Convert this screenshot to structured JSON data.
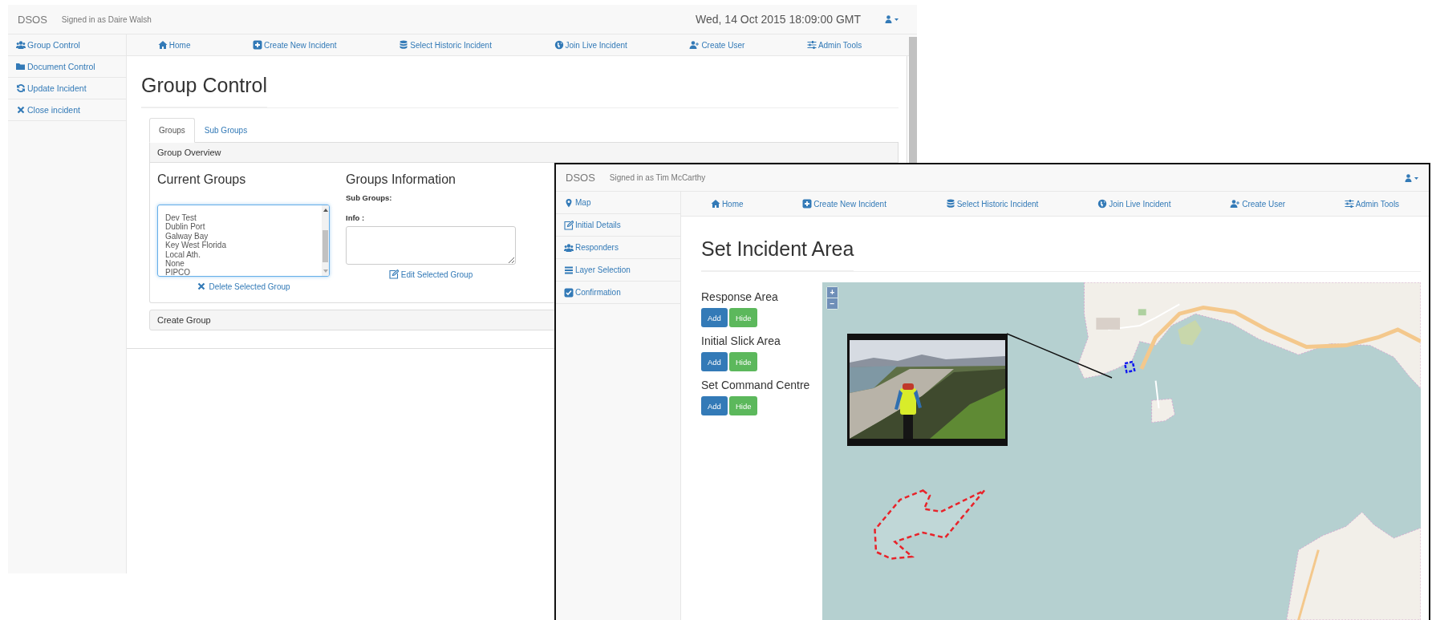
{
  "group_window": {
    "brand": "DSOS",
    "signed_in": "Signed in as Daire Walsh",
    "datetime": "Wed, 14 Oct 2015 18:09:00 GMT",
    "sidebar": [
      "Group Control",
      "Document Control",
      "Update Incident",
      "Close incident"
    ],
    "nav": [
      "Home",
      "Create New Incident",
      "Select Historic Incident",
      "Join Live Incident",
      "Create User",
      "Admin Tools"
    ],
    "title": "Group Control",
    "tabs": [
      {
        "label": "Groups",
        "selected": true
      },
      {
        "label": "Sub Groups",
        "selected": false
      }
    ],
    "overview": {
      "header": "Group Overview",
      "current_heading": "Current Groups",
      "groups": [
        "Dev Test",
        "Dublin Port",
        "Galway Bay",
        "Key West Florida",
        "Local Ath.",
        "None",
        "PIPCO"
      ],
      "delete_action": "Delete Selected Group",
      "info_heading": "Groups Information",
      "sub_groups_label": "Sub Groups:",
      "info_label": "Info :",
      "edit_action": "Edit Selected Group"
    },
    "create_group": "Create Group"
  },
  "incident_window": {
    "brand": "DSOS",
    "signed_in": "Signed in as Tim McCarthy",
    "sidebar": [
      "Map",
      "Initial Details",
      "Responders",
      "Layer Selection",
      "Confirmation"
    ],
    "nav": [
      "Home",
      "Create New Incident",
      "Select Historic Incident",
      "Join Live Incident",
      "Create User",
      "Admin Tools"
    ],
    "title": "Set Incident Area",
    "areas": [
      {
        "heading": "Response Area",
        "buttons": [
          "Add",
          "Hide"
        ]
      },
      {
        "heading": "Initial Slick Area",
        "buttons": [
          "Add",
          "Hide"
        ]
      },
      {
        "heading": "Set Command Centre",
        "buttons": [
          "Add",
          "Hide"
        ]
      }
    ],
    "map": {
      "zoom_in": "+",
      "zoom_out": "−"
    }
  }
}
